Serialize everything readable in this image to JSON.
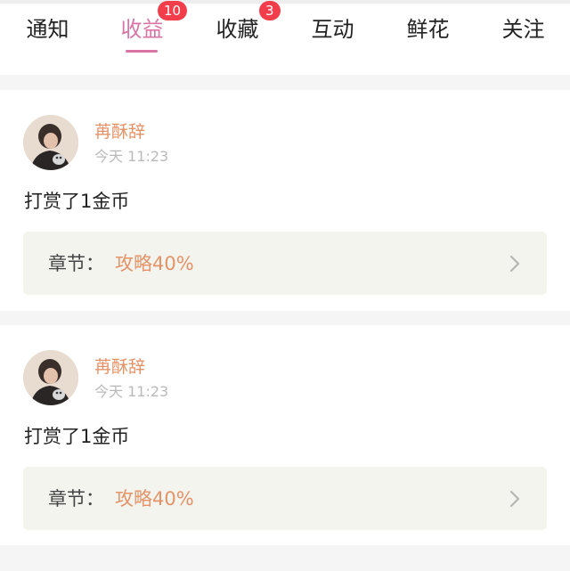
{
  "tabs": [
    {
      "label": "通知",
      "badge": ""
    },
    {
      "label": "收益",
      "badge": "10",
      "active": true
    },
    {
      "label": "收藏",
      "badge": "3"
    },
    {
      "label": "互动",
      "badge": ""
    },
    {
      "label": "鲜花",
      "badge": ""
    },
    {
      "label": "关注",
      "badge": ""
    }
  ],
  "items": [
    {
      "user_name": "苒酥辞",
      "time": "今天 11:23",
      "message": "打赏了1金币",
      "chapter_label": "章节：",
      "chapter_value": "攻略40%"
    },
    {
      "user_name": "苒酥辞",
      "time": "今天 11:23",
      "message": "打赏了1金币",
      "chapter_label": "章节：",
      "chapter_value": "攻略40%"
    }
  ],
  "colors": {
    "active_tab": "#d975a6",
    "badge": "#f23d4a",
    "user_name": "#e49368",
    "chapter_value": "#e49368"
  },
  "icons": [
    "chevron-right-icon",
    "avatar"
  ]
}
